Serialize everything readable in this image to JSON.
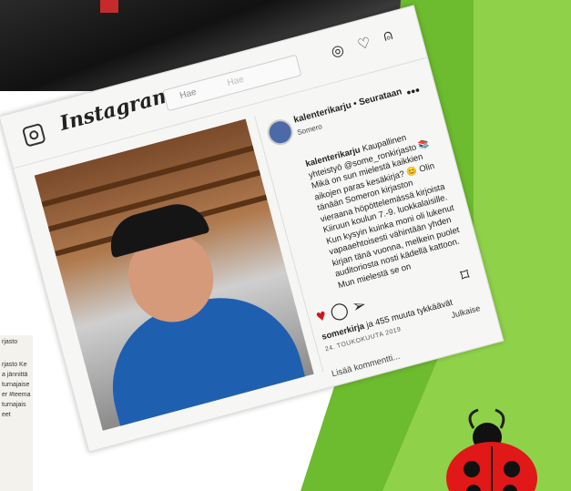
{
  "app": {
    "logo": "Instagram"
  },
  "search": {
    "prefix": "Hae",
    "placeholder": "Hae"
  },
  "post": {
    "account": "kalenterikarju",
    "follow": "Seurataan",
    "account_line": "kalenterikarju • Seurataan",
    "location": "Somero",
    "caption_user": "kalenterikarju",
    "caption": "Kaupallinen yhteistyö @some_ronkirjasto 📚 Mikä on sun mielestä kaikkien aikojen paras kesäkirja? 😊 Olin tänään Someron kirjaston vieraana höpöttelemässä kirjoista Kiiruun koulun 7.-9. luokkalaisille. Kun kysyin kuinka moni oli lukenut vapaaehtoisesti vähintään yhden kirjan tänä vuonna, melkein puolet auditoriosta nosti kädellä kattoon. Mun mielestä se on",
    "likes_user": "somerkirja",
    "likes_text": "ja 455 muuta tykkäävät",
    "date": "24. TOUKOKUUTA 2019",
    "publish_label": "Julkaise",
    "comment_placeholder": "Lisää kommentti..."
  },
  "left_paper": {
    "lines": [
      "rjasto",
      "rjasto Ke",
      "a jännittä",
      "turnajaise",
      "er #teema",
      "turnajais",
      "eet"
    ]
  },
  "icons": [
    "instagram-glyph-icon",
    "compass-icon",
    "heart-icon",
    "user-icon",
    "comment-icon",
    "share-icon",
    "bookmark-icon",
    "more-icon"
  ],
  "colors": {
    "like": "#d01818",
    "green_accent": "#6dbb2e"
  }
}
